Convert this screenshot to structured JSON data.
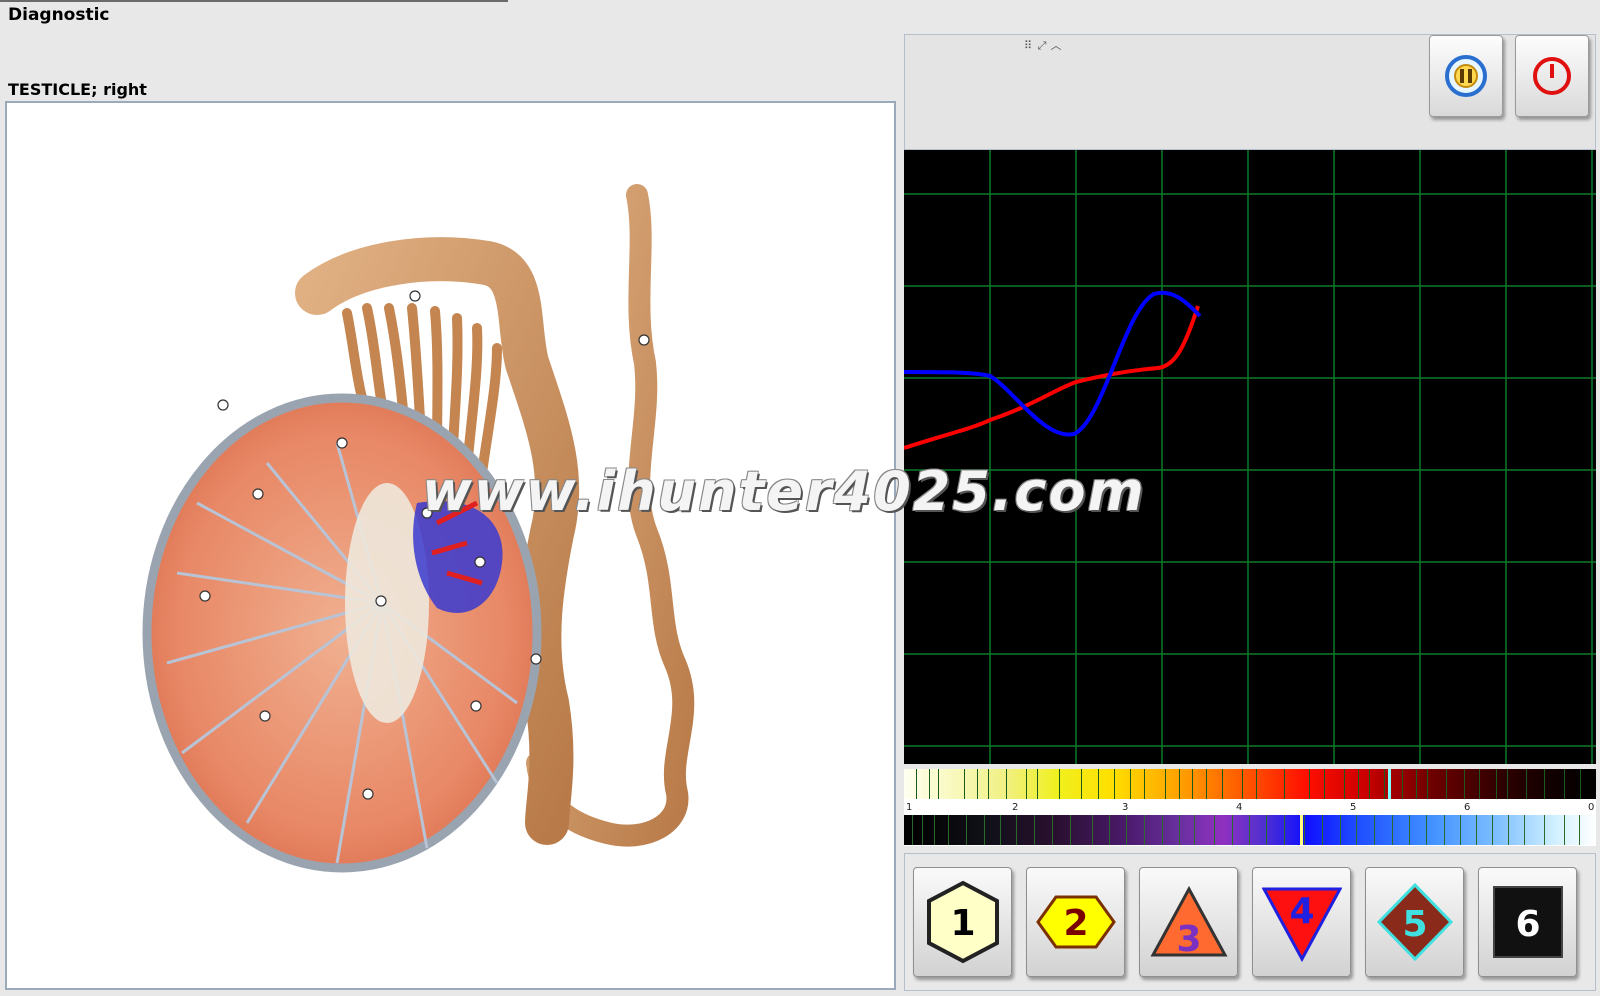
{
  "window": {
    "title": "Diagnostic"
  },
  "organ": {
    "name": "TESTICLE; right"
  },
  "watermark": "www.ihunter4025.com",
  "controls": {
    "pause_icon": "pause-icon",
    "power_icon": "power-icon"
  },
  "graph": {
    "background": "#000000",
    "grid_color": "#0a7a2a",
    "series": [
      {
        "color": "#ff0000",
        "icon": "red-trace"
      },
      {
        "color": "#0000ff",
        "icon": "blue-trace"
      }
    ]
  },
  "spectrum": {
    "scale_labels": [
      "1",
      "2",
      "3",
      "4",
      "5",
      "6",
      "0"
    ]
  },
  "levels": [
    {
      "label": "1",
      "shape": "hexagon",
      "fill": "#ffffc8",
      "text_color": "#000000"
    },
    {
      "label": "2",
      "shape": "hexagon",
      "fill": "#ffff00",
      "text_color": "#7a0000"
    },
    {
      "label": "3",
      "shape": "triangle-up",
      "fill": "#ff6a30",
      "text_color": "#7a30c0"
    },
    {
      "label": "4",
      "shape": "triangle-down",
      "fill": "#ff1010",
      "text_color": "#2020e0"
    },
    {
      "label": "5",
      "shape": "diamond",
      "fill": "#8a2a1a",
      "text_color": "#40e0e0"
    },
    {
      "label": "6",
      "shape": "square",
      "fill": "#111111",
      "text_color": "#ffffff"
    }
  ]
}
